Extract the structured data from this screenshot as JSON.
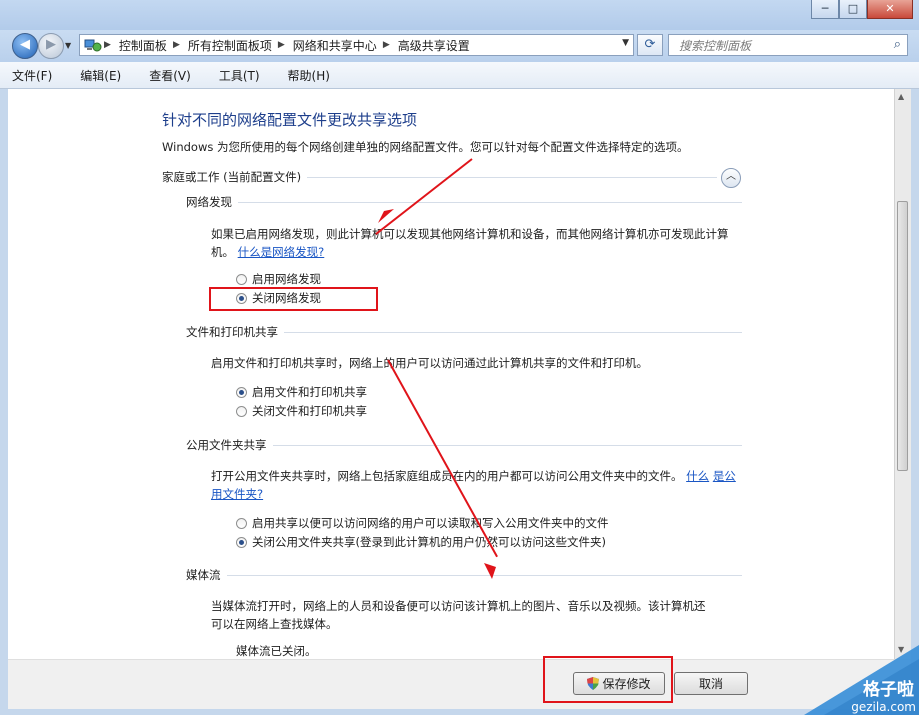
{
  "address": {
    "crumbs": [
      "控制面板",
      "所有控制面板项",
      "网络和共享中心",
      "高级共享设置"
    ],
    "search_placeholder": "搜索控制面板"
  },
  "window_buttons": {
    "minimize": "─",
    "maximize": "□",
    "close": "✕"
  },
  "menu": [
    "文件(F)",
    "编辑(E)",
    "查看(V)",
    "工具(T)",
    "帮助(H)"
  ],
  "page": {
    "title": "针对不同的网络配置文件更改共享选项",
    "intro": "Windows 为您所使用的每个网络创建单独的网络配置文件。您可以针对每个配置文件选择特定的选项。",
    "profile_title": "家庭或工作 (当前配置文件)",
    "sections": {
      "discovery": {
        "title": "网络发现",
        "desc": "如果已启用网络发现，则此计算机可以发现其他网络计算机和设备，而其他网络计算机亦可发现此计算机。",
        "link": "什么是网络发现?",
        "options": [
          {
            "label": "启用网络发现",
            "checked": false
          },
          {
            "label": "关闭网络发现",
            "checked": true
          }
        ]
      },
      "printer": {
        "title": "文件和打印机共享",
        "desc": "启用文件和打印机共享时，网络上的用户可以访问通过此计算机共享的文件和打印机。",
        "options": [
          {
            "label": "启用文件和打印机共享",
            "checked": true
          },
          {
            "label": "关闭文件和打印机共享",
            "checked": false
          }
        ]
      },
      "public": {
        "title": "公用文件夹共享",
        "desc": "打开公用文件夹共享时，网络上包括家庭组成员在内的用户都可以访问公用文件夹中的文件。",
        "link_a": "什么",
        "link_b": "是公用文件夹?",
        "options": [
          {
            "label": "启用共享以便可以访问网络的用户可以读取和写入公用文件夹中的文件",
            "checked": false
          },
          {
            "label": "关闭公用文件夹共享(登录到此计算机的用户仍然可以访问这些文件夹)",
            "checked": true
          }
        ]
      },
      "media": {
        "title": "媒体流",
        "desc_line1": "当媒体流打开时，网络上的人员和设备便可以访问该计算机上的图片、音乐以及视频。该计算机还",
        "desc_line2": "可以在网络上查找媒体。",
        "status": "媒体流已关闭。"
      }
    }
  },
  "buttons": {
    "save": "保存修改",
    "cancel": "取消"
  },
  "watermark": {
    "line1": "格子啦",
    "line2": "gezila.com"
  },
  "colors": {
    "annotation_red": "#e0141a",
    "title_blue": "#1e3f8c",
    "link_blue": "#1a56c4"
  }
}
